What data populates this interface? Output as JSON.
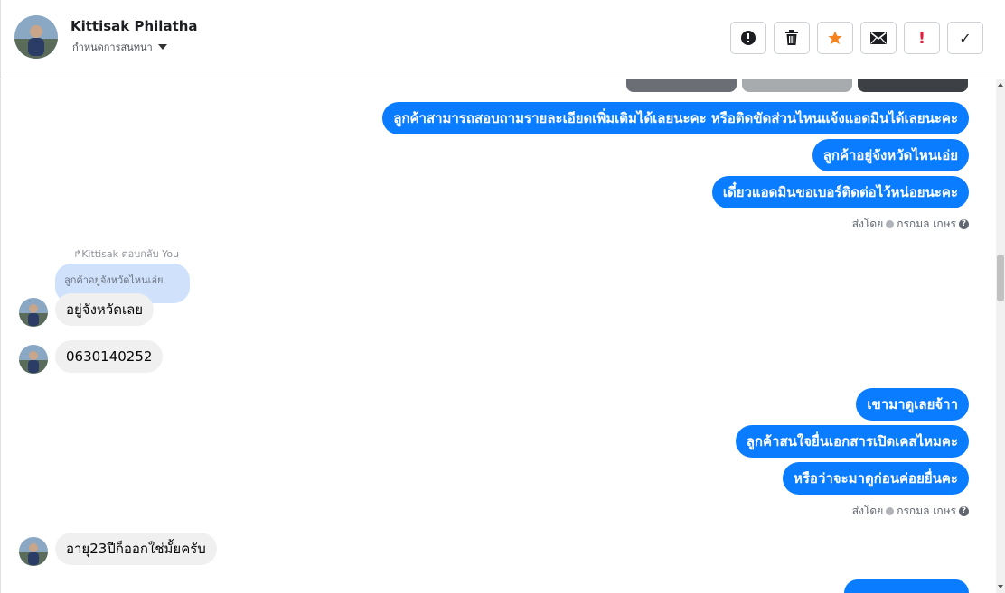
{
  "header": {
    "user_name": "Kittisak Philatha",
    "user_subtitle": "กำหนดการสนทนา",
    "toolbar": {
      "spam": "!",
      "check": "✓"
    },
    "accent_colors": {
      "star": "#f5821f",
      "spam": "#e41e3f",
      "blue": "#0a7cff"
    }
  },
  "messages": {
    "out_1": "ลูกค้าสามารถสอบถามรายละเอียดเพิ่มเติมได้เลยนะคะ หรือติดขัดส่วนไหนแจ้งแอดมินได้เลยนะคะ",
    "out_2": "ลูกค้าอยู่จังหวัดไหนเอ่ย",
    "out_3": "เดี๋ยวแอดมินขอเบอร์ติดต่อไว้หน่อยนะคะ",
    "sent_by_1": "ส่งโดย",
    "sender_1": "กรกมล เกษร",
    "reply_meta": "Kittisak ตอบกลับ You",
    "reply_quote": "ลูกค้าอยู่จังหวัดไหนเอ่ย",
    "in_1": "อยู่จังหวัดเลย",
    "in_2": "0630140252",
    "out_4": "เขามาดูเลยจ้าา",
    "out_5": "ลูกค้าสนใจยื่นเอกสารเปิดเคสไหมคะ",
    "out_6": "หรือว่าจะมาดูก่อนค่อยยื่นคะ",
    "sent_by_2": "ส่งโดย",
    "sender_2": "กรกมล เกษร",
    "in_3": "อายุ23ปีก็ออกใช่มั้ยครับ"
  }
}
